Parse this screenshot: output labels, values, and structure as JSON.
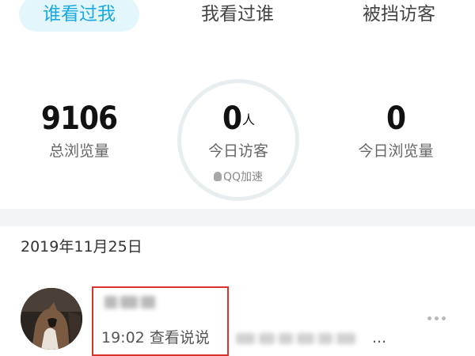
{
  "tabs": [
    {
      "label": "谁看过我",
      "active": true
    },
    {
      "label": "我看过谁",
      "active": false
    },
    {
      "label": "被挡访客",
      "active": false
    }
  ],
  "stats": {
    "total_views": {
      "value": "9106",
      "label": "总浏览量"
    },
    "today_visitors": {
      "value": "0",
      "unit": "人",
      "label": "今日访客"
    },
    "today_views": {
      "value": "0",
      "label": "今日浏览量"
    },
    "badge": "QQ加速"
  },
  "list": {
    "date": "2019年11月25日",
    "items": [
      {
        "time": "19:02",
        "action": "查看说说",
        "ellipsis": "..."
      }
    ]
  },
  "colors": {
    "accent": "#1aa9e0",
    "active_tab_bg": "#e3f6fc",
    "highlight_border": "#d9312b",
    "divider": "#f3f4f6"
  },
  "icons": [
    "qq-penguin-icon",
    "more-dots-icon"
  ]
}
